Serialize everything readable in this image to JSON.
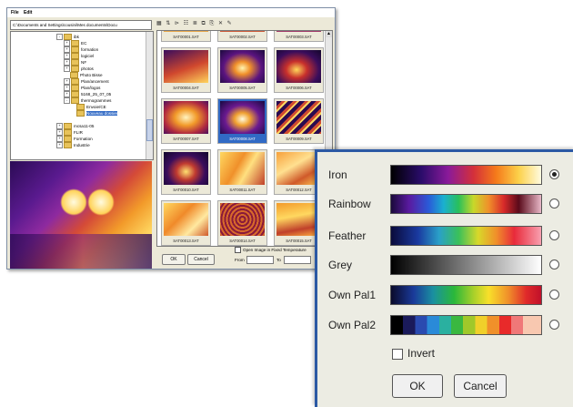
{
  "window": {
    "menu": [
      "File",
      "Edit"
    ],
    "path": "C:\\Documents and Settings\\cousini\\Mes documents\\Docu"
  },
  "tree": {
    "items": [
      {
        "label": "ibk",
        "toggle": "-"
      },
      {
        "label": "EC",
        "toggle": "+"
      },
      {
        "label": "formation",
        "toggle": "+"
      },
      {
        "label": "logiciel",
        "toggle": "+"
      },
      {
        "label": "NF",
        "toggle": "+"
      },
      {
        "label": "photos",
        "toggle": "+"
      },
      {
        "label": "Photo Bisse",
        "toggle": ""
      },
      {
        "label": "Plan/ancement",
        "toggle": "+"
      },
      {
        "label": "Plan/logos",
        "toggle": "+"
      },
      {
        "label": "5168_25_07_05",
        "toggle": "+"
      },
      {
        "label": "thermogrammes",
        "toggle": "-"
      },
      {
        "label": "Envoie/CE",
        "toggle": ""
      },
      {
        "label": "Nouveau dossier",
        "toggle": ""
      },
      {
        "label": "mcsa11-05",
        "toggle": "+"
      },
      {
        "label": "FLIR",
        "toggle": "+"
      },
      {
        "label": "Formation",
        "toggle": "+"
      },
      {
        "label": "Industrie",
        "toggle": "+"
      }
    ]
  },
  "thumbnails": {
    "top_captions": [
      "SAT00001.SAT",
      "SAT00002.SAT",
      "SAT00003.SAT"
    ],
    "items": [
      {
        "caption": "SAT00004.SAT"
      },
      {
        "caption": "SAT00005.SAT"
      },
      {
        "caption": "SAT00006.SAT"
      },
      {
        "caption": "SAT00007.SAT"
      },
      {
        "caption": "SAT00008.SAT"
      },
      {
        "caption": "SAT00009.SAT"
      },
      {
        "caption": "SAT00010.SAT"
      },
      {
        "caption": "SAT00011.SAT"
      },
      {
        "caption": "SAT00012.SAT"
      },
      {
        "caption": "SAT00013.SAT"
      },
      {
        "caption": "SAT00014.SAT"
      },
      {
        "caption": "SAT00015.SAT"
      }
    ]
  },
  "bottom": {
    "ok": "OK",
    "cancel": "Cancel",
    "fixed_temp": "Open Image in Fixed Temperature",
    "from": "From",
    "to": "To"
  },
  "palette_dialog": {
    "palettes": [
      {
        "label": "Iron",
        "selected": true
      },
      {
        "label": "Rainbow",
        "selected": false
      },
      {
        "label": "Feather",
        "selected": false
      },
      {
        "label": "Grey",
        "selected": false
      },
      {
        "label": "Own Pal1",
        "selected": false
      },
      {
        "label": "Own Pal2",
        "selected": false
      }
    ],
    "invert_label": "Invert",
    "ok": "OK",
    "cancel": "Cancel"
  }
}
